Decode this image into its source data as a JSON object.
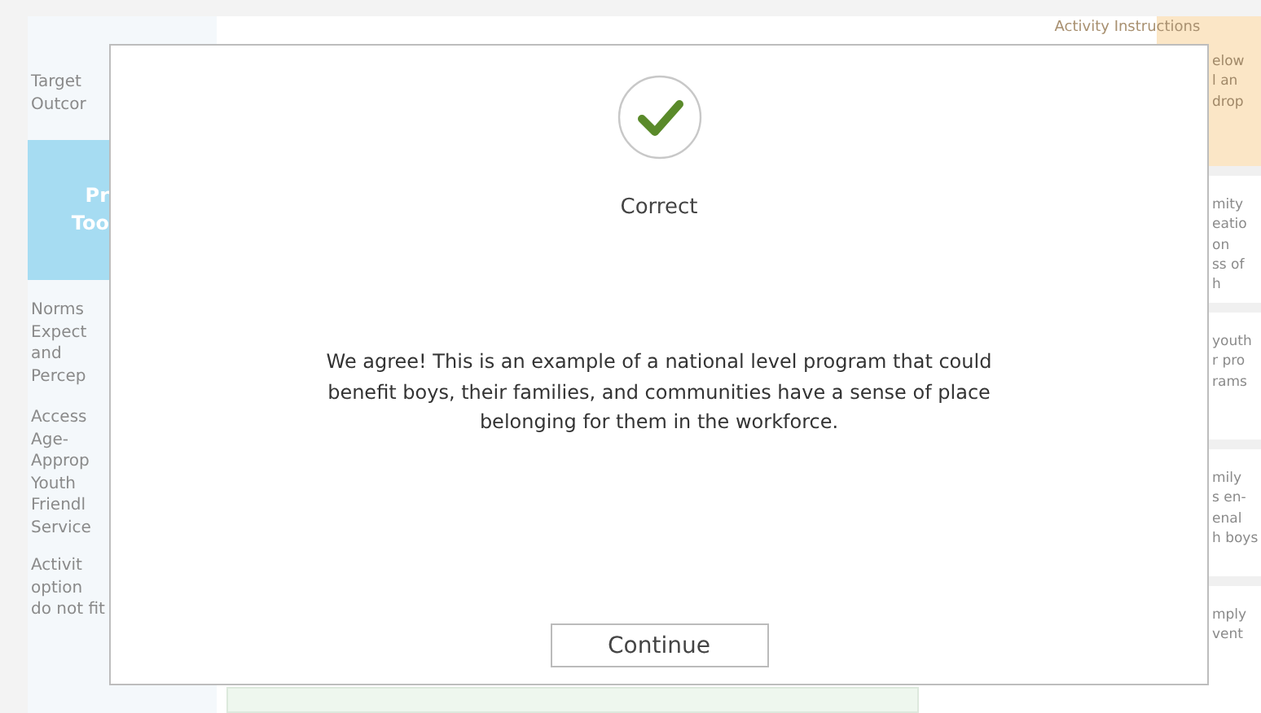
{
  "background": {
    "left_column": {
      "heading": [
        "Target",
        "Outcor"
      ],
      "tool_tab": [
        "Pr",
        "Too"
      ],
      "rows": [
        [
          "Norms",
          "Expect",
          "and",
          "Percep"
        ],
        [
          "Access",
          "Age-",
          "Approp",
          "Youth",
          "Friendl",
          "Service"
        ],
        [
          "Activit",
          "option",
          "do not fit"
        ]
      ]
    },
    "right_column": {
      "title": "Activity Instructions",
      "heading": [
        "elow",
        "l an",
        "drop"
      ],
      "rows": [
        [
          "mity",
          "eatio",
          "on",
          "ss of",
          "h"
        ],
        [
          "youth",
          "r pro",
          "rams"
        ],
        [
          "mily",
          "s en-",
          "enal",
          "h boys"
        ],
        [
          "mply",
          "vent"
        ]
      ]
    }
  },
  "dialog": {
    "title": "Correct",
    "message": "We agree! This is an example of a national level program that could benefit boys, their families, and communities have a sense of place belonging for them in the workforce.",
    "button": "Continue"
  }
}
